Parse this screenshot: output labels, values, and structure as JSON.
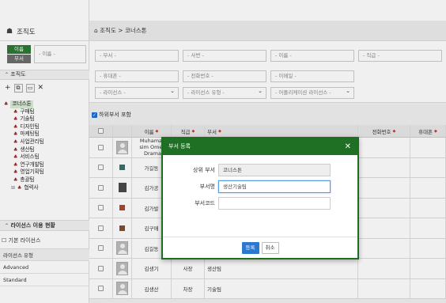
{
  "left": {
    "title": "조직도",
    "filter": {
      "active": "이름",
      "inactive": "부서",
      "select_placeholder": "- 이름 -"
    },
    "org_section": "조직도",
    "tree": {
      "root": "코너스톤",
      "children": [
        "구매팀",
        "기술팀",
        "디자인팀",
        "마케팅팀",
        "사업관리팀",
        "생산팀",
        "서비스팀",
        "연구개발팀",
        "영업기획팀",
        "총괄팀"
      ],
      "partner": "협력사"
    },
    "license": {
      "section": "라이선스 이용 현황",
      "basic_check": "기본 라이선스",
      "type_header": "라이선스 유형",
      "types": [
        "Advanced",
        "Standard"
      ]
    }
  },
  "breadcrumb": {
    "home": "조직도",
    "sep": ">",
    "current": "코너스톤"
  },
  "search": {
    "row1": [
      "- 부서 -",
      "- 사번 -",
      "- 이름 -",
      "- 직급 -"
    ],
    "row2": [
      "- 휴대폰 -",
      "- 전화번호 -",
      "- 이메일 -"
    ],
    "row3": [
      "- 라이선스 -",
      "- 라이선스 유형 -",
      "- 어플리케이션 라이선스 -"
    ]
  },
  "include_sub": "하위부서 포함",
  "grid": {
    "headers": {
      "name": "이름",
      "rank": "직급",
      "dept": "부서",
      "phone": "전화번호",
      "mobile": "휴대폰"
    },
    "rows": [
      {
        "name": "Muhamad",
        "name2": "sim Omeg",
        "name3": "Drama",
        "rank": "",
        "dept": ""
      },
      {
        "name": "가길동",
        "rank": "",
        "dept": ""
      },
      {
        "name": "김가공",
        "rank": "",
        "dept": ""
      },
      {
        "name": "김가발",
        "rank": "",
        "dept": ""
      },
      {
        "name": "김구매",
        "rank": "",
        "dept": ""
      },
      {
        "name": "김길동",
        "rank": "",
        "dept": ""
      },
      {
        "name": "김생기",
        "rank": "사장",
        "dept": "생산팀"
      },
      {
        "name": "김생산",
        "rank": "차장",
        "dept": "기술팀"
      }
    ]
  },
  "modal": {
    "title": "부서 등록",
    "parent_label": "상위 부서",
    "parent_value": "코너스톤",
    "name_label": "부서명",
    "name_value": "생산기술팀",
    "code_label": "부서코드",
    "code_value": "",
    "ok": "등록",
    "cancel": "취소"
  },
  "colors": {
    "brand_green": "#1f6f24",
    "primary_blue": "#2a78cf",
    "tree_icon": "#a01818"
  }
}
